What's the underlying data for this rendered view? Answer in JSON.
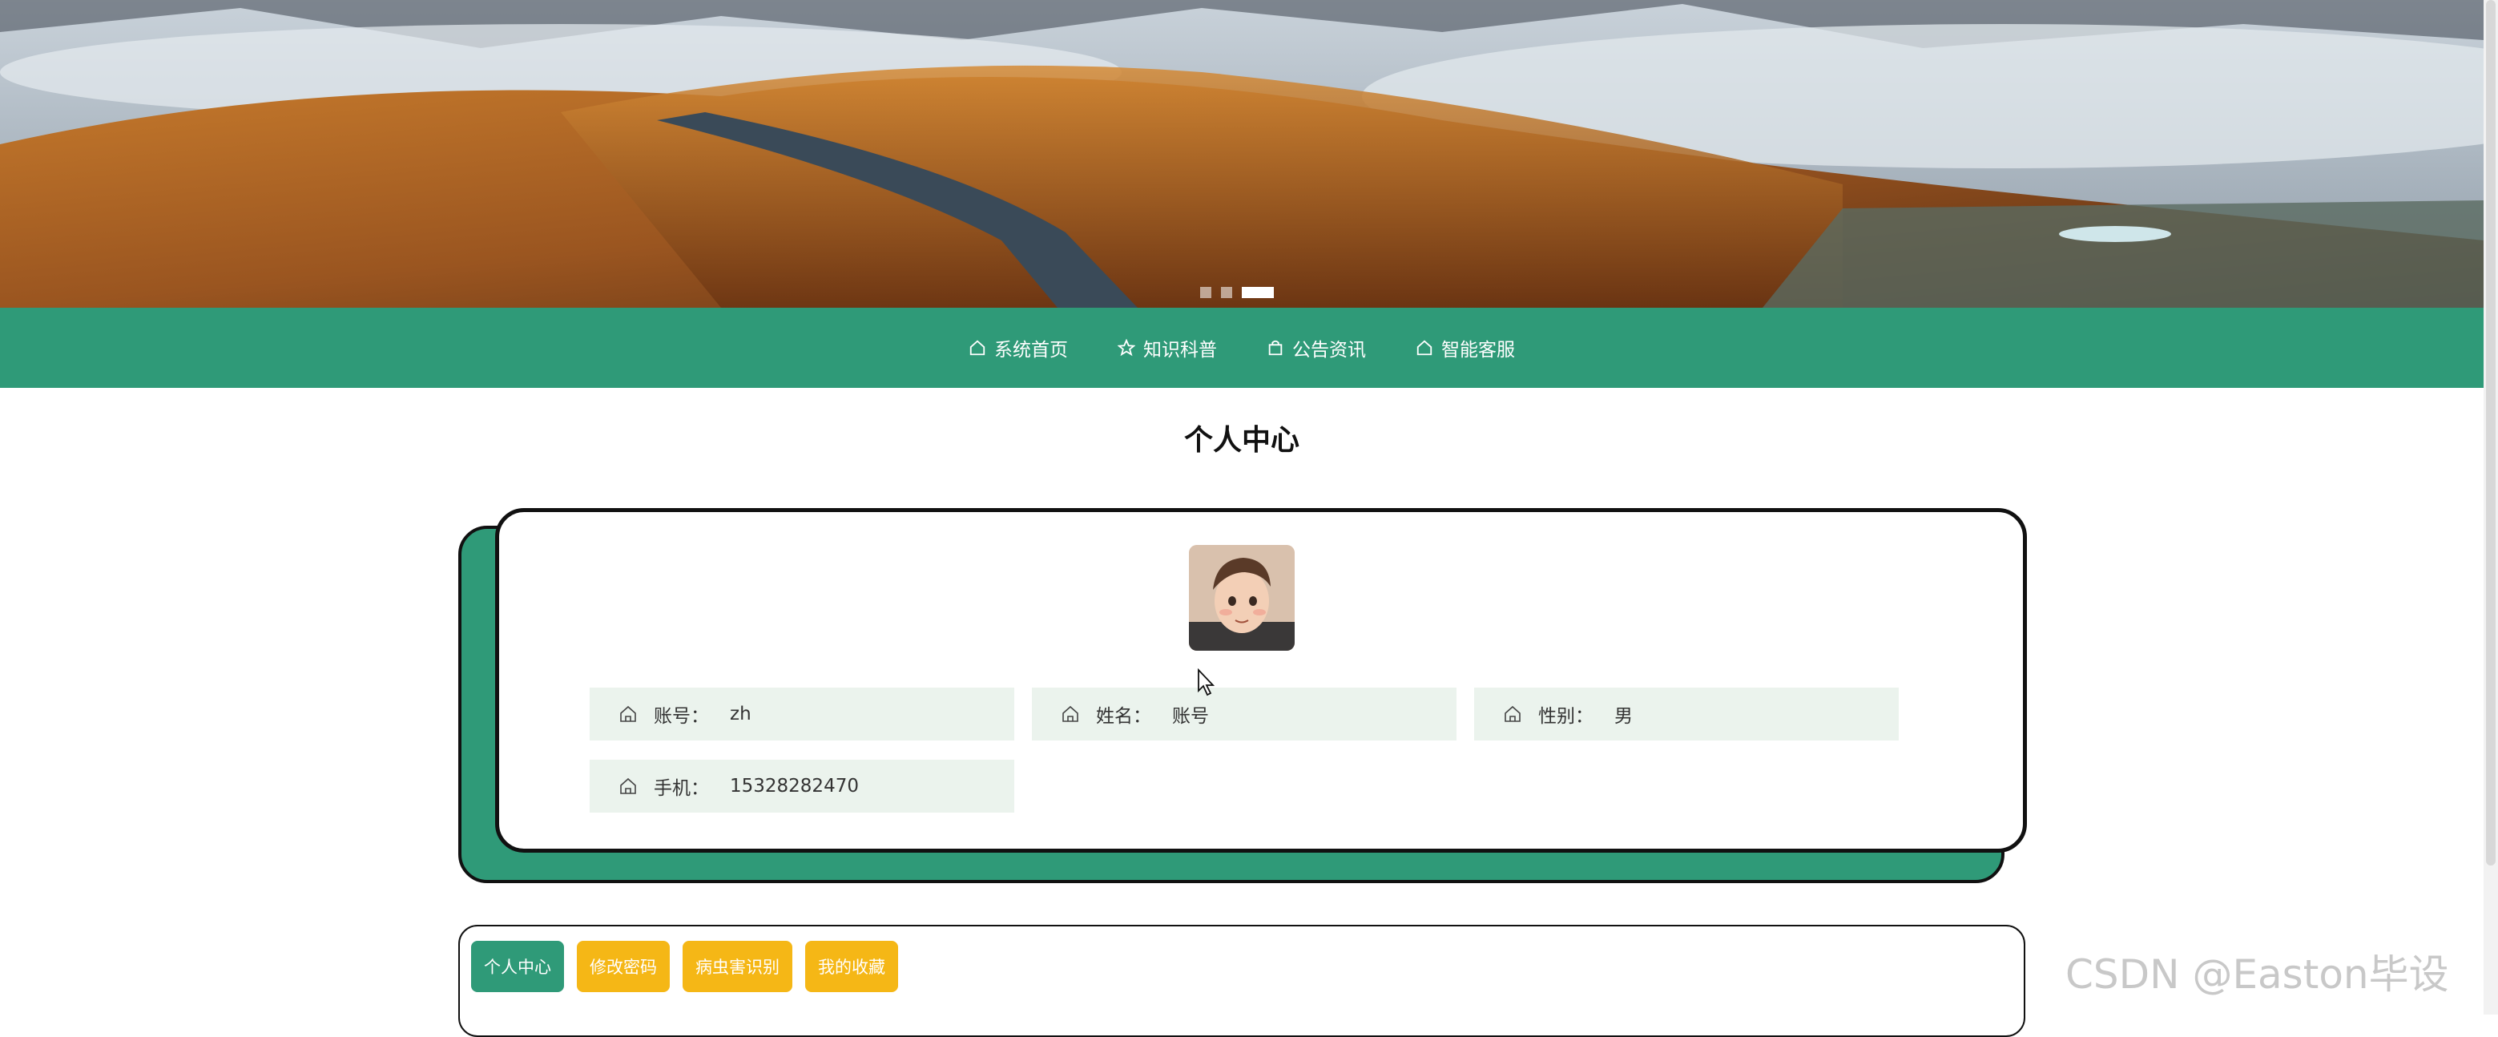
{
  "nav": {
    "items": [
      {
        "label": "系统首页",
        "icon": "home-icon"
      },
      {
        "label": "知识科普",
        "icon": "star-icon"
      },
      {
        "label": "公告资讯",
        "icon": "bag-icon"
      },
      {
        "label": "智能客服",
        "icon": "home-icon"
      }
    ]
  },
  "page": {
    "title": "个人中心"
  },
  "profile": {
    "avatar": "avatar-illustration",
    "fields": [
      {
        "label": "账号：",
        "value": "zh"
      },
      {
        "label": "姓名：",
        "value": "账号"
      },
      {
        "label": "性别：",
        "value": "男"
      },
      {
        "label": "手机：",
        "value": "15328282470"
      }
    ]
  },
  "tabs": [
    {
      "label": "个人中心",
      "active": true
    },
    {
      "label": "修改密码",
      "active": false
    },
    {
      "label": "病虫害识别",
      "active": false
    },
    {
      "label": "我的收藏",
      "active": false
    }
  ],
  "watermark": "CSDN @Easton毕设",
  "colors": {
    "primary": "#2f9a78",
    "accent": "#f5b716",
    "field_bg": "#ebf3ed"
  }
}
